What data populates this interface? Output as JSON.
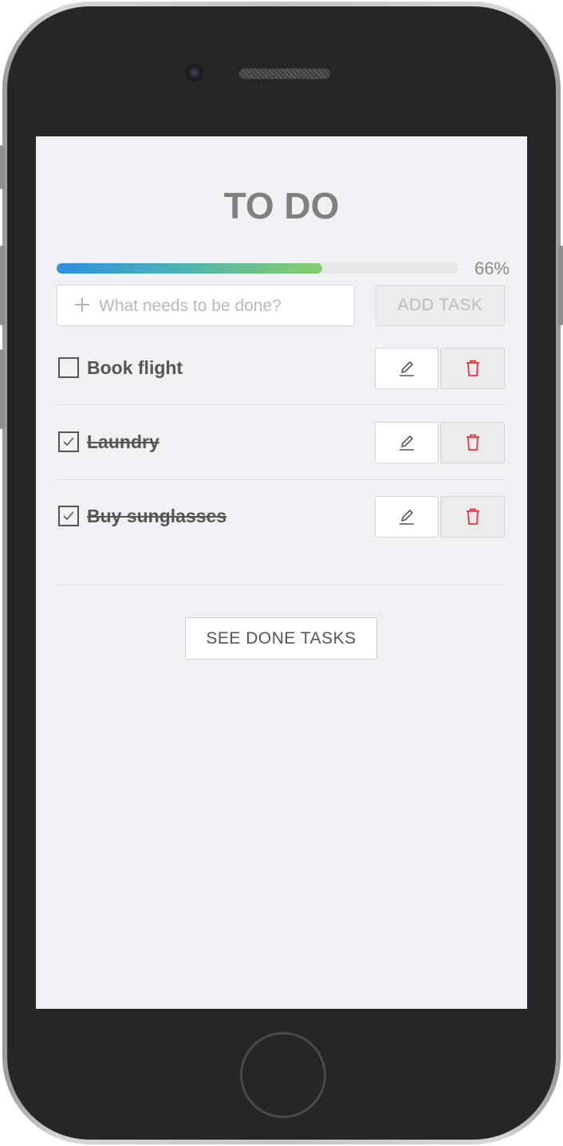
{
  "app": {
    "title": "TO DO"
  },
  "progress": {
    "fraction": 0.66,
    "label": "66%"
  },
  "new_task": {
    "placeholder": "What needs to be done?",
    "value": "",
    "add_label": "ADD TASK"
  },
  "tasks": [
    {
      "label": "Book flight",
      "done": false
    },
    {
      "label": "Laundry",
      "done": true
    },
    {
      "label": "Buy sunglasses",
      "done": true
    }
  ],
  "footer": {
    "see_done_label": "SEE DONE TASKS"
  },
  "icons": {
    "add": "plus-icon",
    "edit": "pencil-icon",
    "delete": "trash-icon",
    "check": "checkmark-icon"
  },
  "colors": {
    "screen_bg": "#f0f1f4",
    "text": "#555555",
    "title": "#808080",
    "delete_accent": "#e8323c",
    "progress_start": "#2f8fe0",
    "progress_end": "#87cf6b"
  }
}
